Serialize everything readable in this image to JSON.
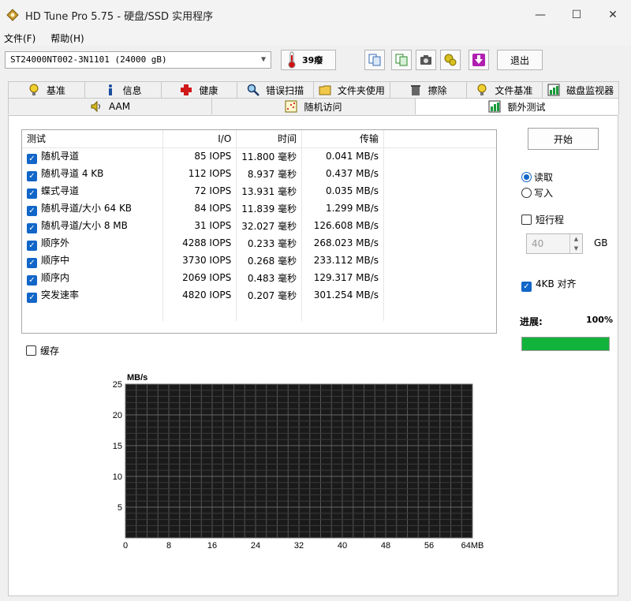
{
  "window": {
    "title": "HD Tune Pro 5.75 - 硬盘/SSD 实用程序",
    "minimize": "—",
    "maximize": "☐",
    "close": "✕"
  },
  "menu": [
    {
      "label": "文件(F)"
    },
    {
      "label": "帮助(H)"
    }
  ],
  "toolbar": {
    "drive": "ST24000NT002-3N1101 (24000 gB)",
    "temperature": "39癈",
    "exit_label": "退出",
    "icons": [
      "copy-info-icon",
      "copy-icon",
      "camera-icon",
      "options-icon",
      "save-arrow-icon"
    ]
  },
  "tabs_row1": [
    {
      "label": "基准",
      "icon": "bulb-icon"
    },
    {
      "label": "信息",
      "icon": "info-icon"
    },
    {
      "label": "健康",
      "icon": "health-cross-icon"
    },
    {
      "label": "错误扫描",
      "icon": "magnifier-icon"
    },
    {
      "label": "文件夹使用",
      "icon": "folder-icon"
    },
    {
      "label": "擦除",
      "icon": "trash-icon"
    },
    {
      "label": "文件基准",
      "icon": "file-benchmark-icon"
    },
    {
      "label": "磁盘监视器",
      "icon": "disk-monitor-icon"
    }
  ],
  "tabs_row2": [
    {
      "label": "AAM",
      "icon": "speaker-icon"
    },
    {
      "label": "随机访问",
      "icon": "random-access-icon"
    },
    {
      "label": "额外测试",
      "icon": "extra-tests-icon"
    }
  ],
  "table": {
    "headers": [
      "测试",
      "I/O",
      "时间",
      "传输"
    ],
    "rows": [
      {
        "name": "随机寻道",
        "io": "85 IOPS",
        "time": "11.800 毫秒",
        "transfer": "0.041 MB/s"
      },
      {
        "name": "随机寻道 4 KB",
        "io": "112 IOPS",
        "time": "8.937 毫秒",
        "transfer": "0.437 MB/s"
      },
      {
        "name": "蝶式寻道",
        "io": "72 IOPS",
        "time": "13.931 毫秒",
        "transfer": "0.035 MB/s"
      },
      {
        "name": "随机寻道/大小 64 KB",
        "io": "84 IOPS",
        "time": "11.839 毫秒",
        "transfer": "1.299 MB/s"
      },
      {
        "name": "随机寻道/大小 8 MB",
        "io": "31 IOPS",
        "time": "32.027 毫秒",
        "transfer": "126.608 MB/s"
      },
      {
        "name": "顺序外",
        "io": "4288 IOPS",
        "time": "0.233 毫秒",
        "transfer": "268.023 MB/s"
      },
      {
        "name": "顺序中",
        "io": "3730 IOPS",
        "time": "0.268 毫秒",
        "transfer": "233.112 MB/s"
      },
      {
        "name": "顺序内",
        "io": "2069 IOPS",
        "time": "0.483 毫秒",
        "transfer": "129.317 MB/s"
      },
      {
        "name": "突发速率",
        "io": "4820 IOPS",
        "time": "0.207 毫秒",
        "transfer": "301.254 MB/s"
      }
    ]
  },
  "cache_label": "缓存",
  "panel": {
    "start_label": "开始",
    "read_label": "读取",
    "write_label": "写入",
    "short_stroke_label": "短行程",
    "short_stroke_value": "40",
    "gb_label": "GB",
    "align_label": "4KB 对齐",
    "progress_label": "进展:",
    "progress_text": "100%",
    "progress_fraction": 1.0
  },
  "chart_data": {
    "type": "line",
    "ylabel": "MB/s",
    "xlabel": "",
    "xunit": "MB",
    "ylim": [
      0,
      25
    ],
    "xlim": [
      0,
      64
    ],
    "yticks": [
      "25",
      "20",
      "15",
      "10",
      "5"
    ],
    "xticks": [
      "0",
      "8",
      "16",
      "24",
      "32",
      "40",
      "48",
      "56",
      "64MB"
    ],
    "grid": true,
    "series": []
  },
  "colors": {
    "checkbox": "#1166c8",
    "progress": "#11b33a",
    "chart_bg": "#1a1a1a",
    "grid": "#555555"
  }
}
